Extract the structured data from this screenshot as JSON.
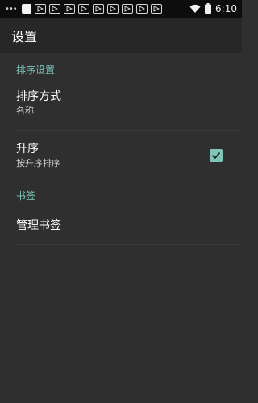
{
  "status_bar": {
    "time": "6:10",
    "notification_icons": [
      "square-icon",
      "play-icon",
      "play-icon",
      "play-icon",
      "play-icon",
      "play-icon",
      "play-icon",
      "play-icon",
      "play-icon",
      "play-icon"
    ]
  },
  "app_bar": {
    "title": "设置"
  },
  "sections": {
    "sort": {
      "header": "排序设置",
      "sort_method": {
        "title": "排序方式",
        "summary": "名称"
      },
      "ascending": {
        "title": "升序",
        "summary": "按升序排序",
        "checked": true
      }
    },
    "bookmarks": {
      "header": "书签",
      "manage": {
        "title": "管理书签"
      }
    }
  },
  "colors": {
    "accent": "#7fc6b8",
    "background": "#2f2f2f",
    "app_bar": "#272727",
    "status_bar": "#0d0d0d"
  }
}
